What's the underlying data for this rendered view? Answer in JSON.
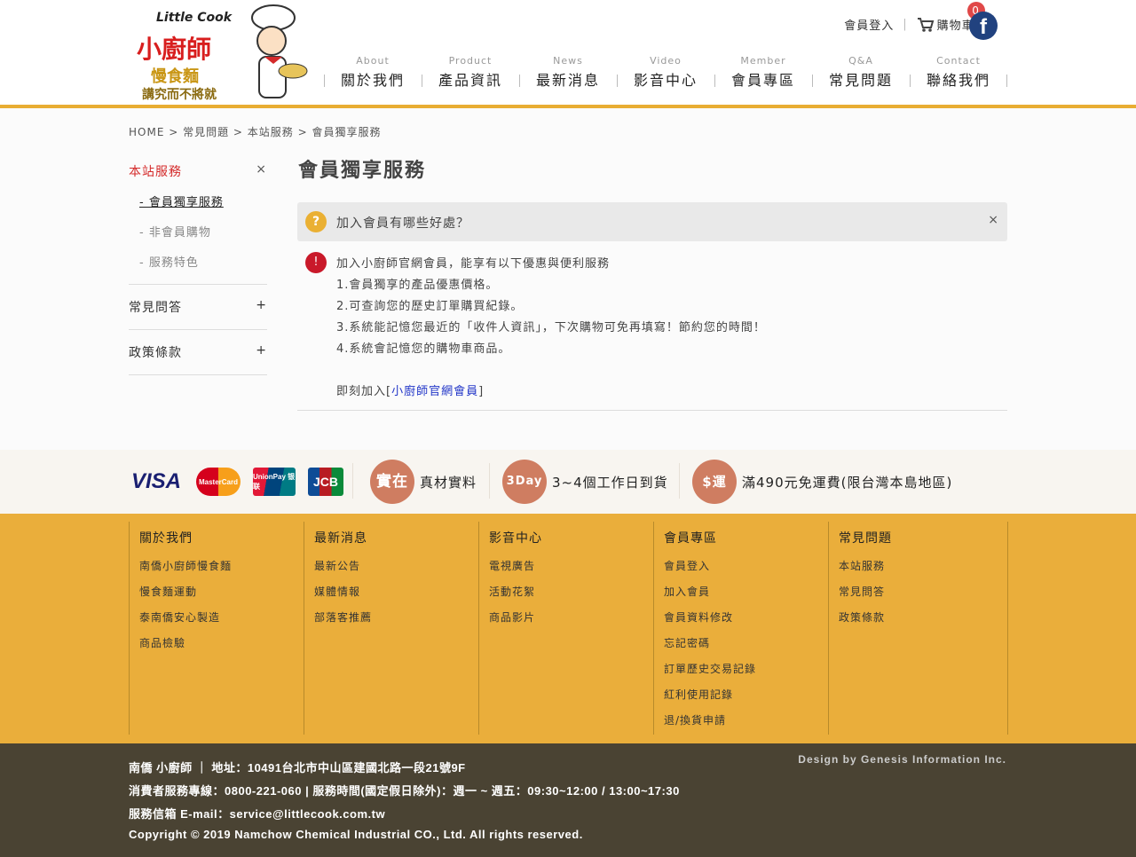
{
  "header": {
    "logo": {
      "en": "Little Cook",
      "name": "小廚師",
      "product": "慢食麵",
      "slogan": "講究而不將就"
    },
    "login": "會員登入",
    "cart": "購物車",
    "cart_count": "0",
    "nav": [
      {
        "en": "About",
        "zh": "關於我們"
      },
      {
        "en": "Product",
        "zh": "產品資訊"
      },
      {
        "en": "News",
        "zh": "最新消息"
      },
      {
        "en": "Video",
        "zh": "影音中心"
      },
      {
        "en": "Member",
        "zh": "會員專區"
      },
      {
        "en": "Q&A",
        "zh": "常見問題"
      },
      {
        "en": "Contact",
        "zh": "聯絡我們"
      }
    ]
  },
  "breadcrumb": [
    "HOME",
    "常見問題",
    "本站服務",
    "會員獨享服務"
  ],
  "sidebar": {
    "groups": [
      {
        "label": "本站服務",
        "toggle": "×",
        "items": [
          "- 會員獨享服務",
          "- 非會員購物",
          "- 服務特色"
        ]
      },
      {
        "label": "常見問答",
        "toggle": "+"
      },
      {
        "label": "政策條款",
        "toggle": "+"
      }
    ]
  },
  "main": {
    "title": "會員獨享服務",
    "question": "加入會員有哪些好處？",
    "q_icon": "?",
    "a_icon": "!",
    "close": "×",
    "answer": [
      "加入小廚師官網會員，能享有以下優惠與便利服務",
      "1.會員獨享的產品優惠價格。",
      "2.可查詢您的歷史訂單購買紀錄。",
      "3.系統能記憶您最近的「收件人資訊」，下次購物可免再填寫！節約您的時間！",
      "4.系統會記憶您的購物車商品。"
    ],
    "join_prefix": "即刻加入[",
    "join_link": "小廚師官網會員",
    "join_suffix": "]"
  },
  "payments": [
    "VISA",
    "MasterCard",
    "UnionPay 银联",
    "JCB"
  ],
  "features": [
    {
      "icon": "實在",
      "label": "真材實料"
    },
    {
      "icon": "3Day",
      "label": "3~4個工作日到貨"
    },
    {
      "icon": "$運",
      "label": "滿490元免運費(限台灣本島地區)"
    }
  ],
  "footer_cols": [
    {
      "title": "關於我們",
      "links": [
        "南僑小廚師慢食麵",
        "慢食麵運動",
        "泰南僑安心製造",
        "商品檢驗"
      ]
    },
    {
      "title": "最新消息",
      "links": [
        "最新公告",
        "媒體情報",
        "部落客推薦"
      ]
    },
    {
      "title": "影音中心",
      "links": [
        "電視廣告",
        "活動花絮",
        "商品影片"
      ]
    },
    {
      "title": "會員專區",
      "links": [
        "會員登入",
        "加入會員",
        "會員資料修改",
        "忘記密碼",
        "訂單歷史交易記錄",
        "紅利使用記錄",
        "退/換貨申請"
      ]
    },
    {
      "title": "常見問題",
      "links": [
        "本站服務",
        "常見問答",
        "政策條款"
      ]
    }
  ],
  "bottom": {
    "lines": [
      "南僑 小廚師 ｜ 地址：10491台北市中山區建國北路一段21號9F",
      "消費者服務專線：0800-221-060 | 服務時間(國定假日除外)：週一 ~ 週五：09:30~12:00 / 13:00~17:30",
      "服務信箱 E-mail：service@littlecook.com.tw",
      "Copyright © 2019 Namchow Chemical Industrial CO., Ltd. All rights reserved."
    ],
    "design": "Design by Genesis Information Inc."
  }
}
